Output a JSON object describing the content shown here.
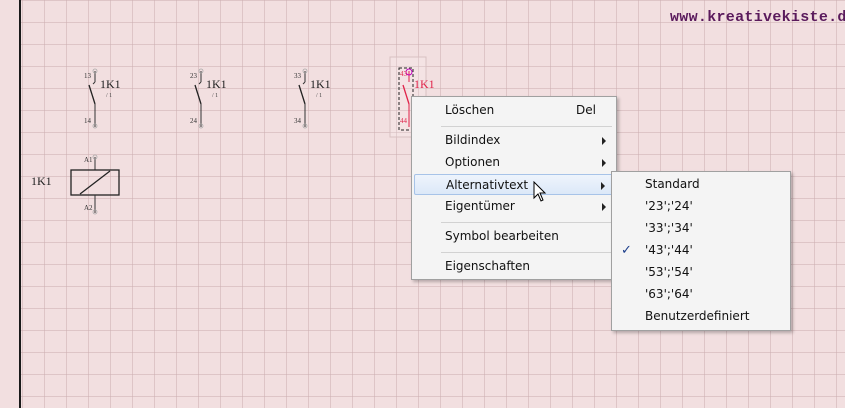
{
  "watermark": "www.kreativekiste.de",
  "schematic": {
    "contacts": [
      {
        "top": "13",
        "bottom": "14",
        "label": "1K1",
        "ref": "/ 1"
      },
      {
        "top": "23",
        "bottom": "24",
        "label": "1K1",
        "ref": "/ 1"
      },
      {
        "top": "33",
        "bottom": "34",
        "label": "1K1",
        "ref": "/ 1"
      },
      {
        "top": "43",
        "bottom": "44",
        "label": "1K1",
        "ref": "/ 1"
      }
    ],
    "coil": {
      "label": "1K1",
      "top": "A1",
      "bottom": "A2"
    }
  },
  "context_menu": {
    "items": [
      {
        "label": "Löschen",
        "shortcut": "Del"
      },
      {
        "label": "Bildindex"
      },
      {
        "label": "Optionen"
      },
      {
        "label": "Alternativtext"
      },
      {
        "label": "Eigentümer"
      },
      {
        "label": "Symbol bearbeiten"
      },
      {
        "label": "Eigenschaften"
      }
    ]
  },
  "submenu": {
    "items": [
      {
        "label": "Standard"
      },
      {
        "label": "'23';'24'"
      },
      {
        "label": "'33';'34'"
      },
      {
        "label": "'43';'44'",
        "checked": "✓"
      },
      {
        "label": "'53';'54'"
      },
      {
        "label": "'63';'64'"
      },
      {
        "label": "Benutzerdefiniert"
      }
    ]
  },
  "colors": {
    "background": "#f2dfe0",
    "selection": "#e0234a",
    "watermark": "#5a1a5c",
    "highlight": "#dce8f8"
  }
}
